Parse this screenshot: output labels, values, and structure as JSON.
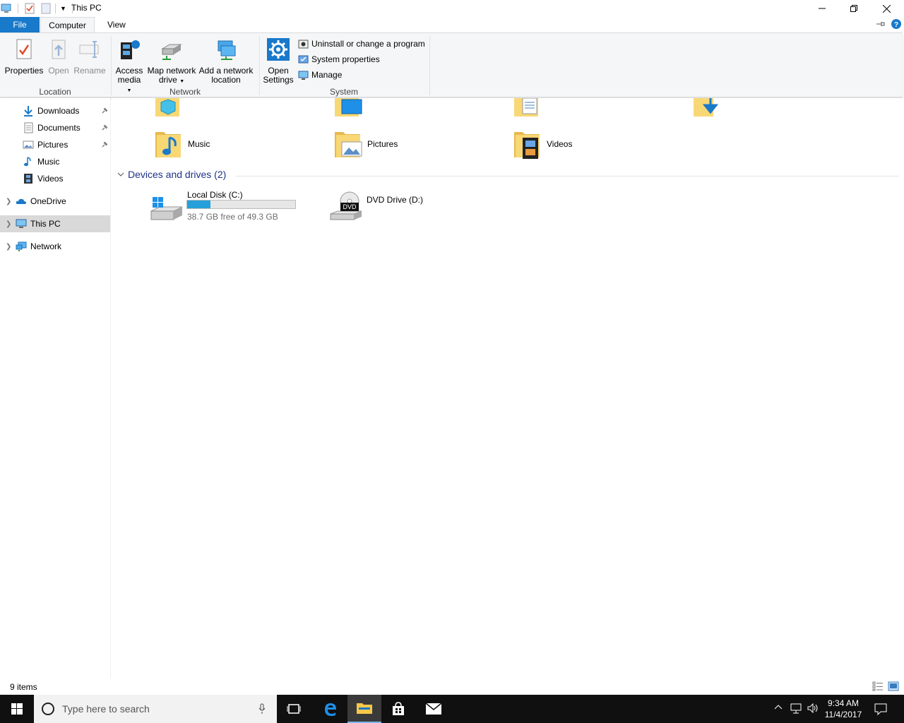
{
  "window": {
    "title": "This PC",
    "controls": {
      "minimize": "minimize-icon",
      "restore": "restore-icon",
      "close": "close-icon"
    }
  },
  "ribbon": {
    "tabs": [
      "File",
      "Computer",
      "View"
    ],
    "groups": {
      "location": {
        "label": "Location",
        "buttons": [
          "Properties",
          "Open",
          "Rename"
        ]
      },
      "network": {
        "label": "Network",
        "access_media": [
          "Access",
          "media"
        ],
        "map_drive": [
          "Map network",
          "drive"
        ],
        "add_location": [
          "Add a network",
          "location"
        ]
      },
      "system": {
        "label": "System",
        "open_settings": [
          "Open",
          "Settings"
        ],
        "small_commands": [
          "Uninstall or change a program",
          "System properties",
          "Manage"
        ]
      }
    }
  },
  "nav": {
    "quick_access": [
      {
        "label": "Downloads",
        "pinned": true,
        "icon": "downloads-icon"
      },
      {
        "label": "Documents",
        "pinned": true,
        "icon": "documents-icon"
      },
      {
        "label": "Pictures",
        "pinned": true,
        "icon": "pictures-icon"
      },
      {
        "label": "Music",
        "pinned": false,
        "icon": "music-icon"
      },
      {
        "label": "Videos",
        "pinned": false,
        "icon": "videos-icon"
      }
    ],
    "roots": [
      {
        "label": "OneDrive",
        "icon": "onedrive-icon"
      },
      {
        "label": "This PC",
        "icon": "this-pc-icon",
        "selected": true
      },
      {
        "label": "Network",
        "icon": "network-icon"
      }
    ]
  },
  "content": {
    "folders": [
      "Music",
      "Pictures",
      "Videos"
    ],
    "devices_header": "Devices and drives (2)",
    "drives": [
      {
        "name": "Local Disk (C:)",
        "free_text": "38.7 GB free of 49.3 GB",
        "used_fraction": 0.215
      },
      {
        "name": "DVD Drive (D:)",
        "badge": "DVD"
      }
    ]
  },
  "status": {
    "items": "9 items"
  },
  "taskbar": {
    "search_placeholder": "Type here to search",
    "clock_time": "9:34 AM",
    "clock_date": "11/4/2017"
  },
  "colors": {
    "accent": "#1979ca",
    "drive_fill": "#26a0da",
    "taskbar": "#101010"
  }
}
